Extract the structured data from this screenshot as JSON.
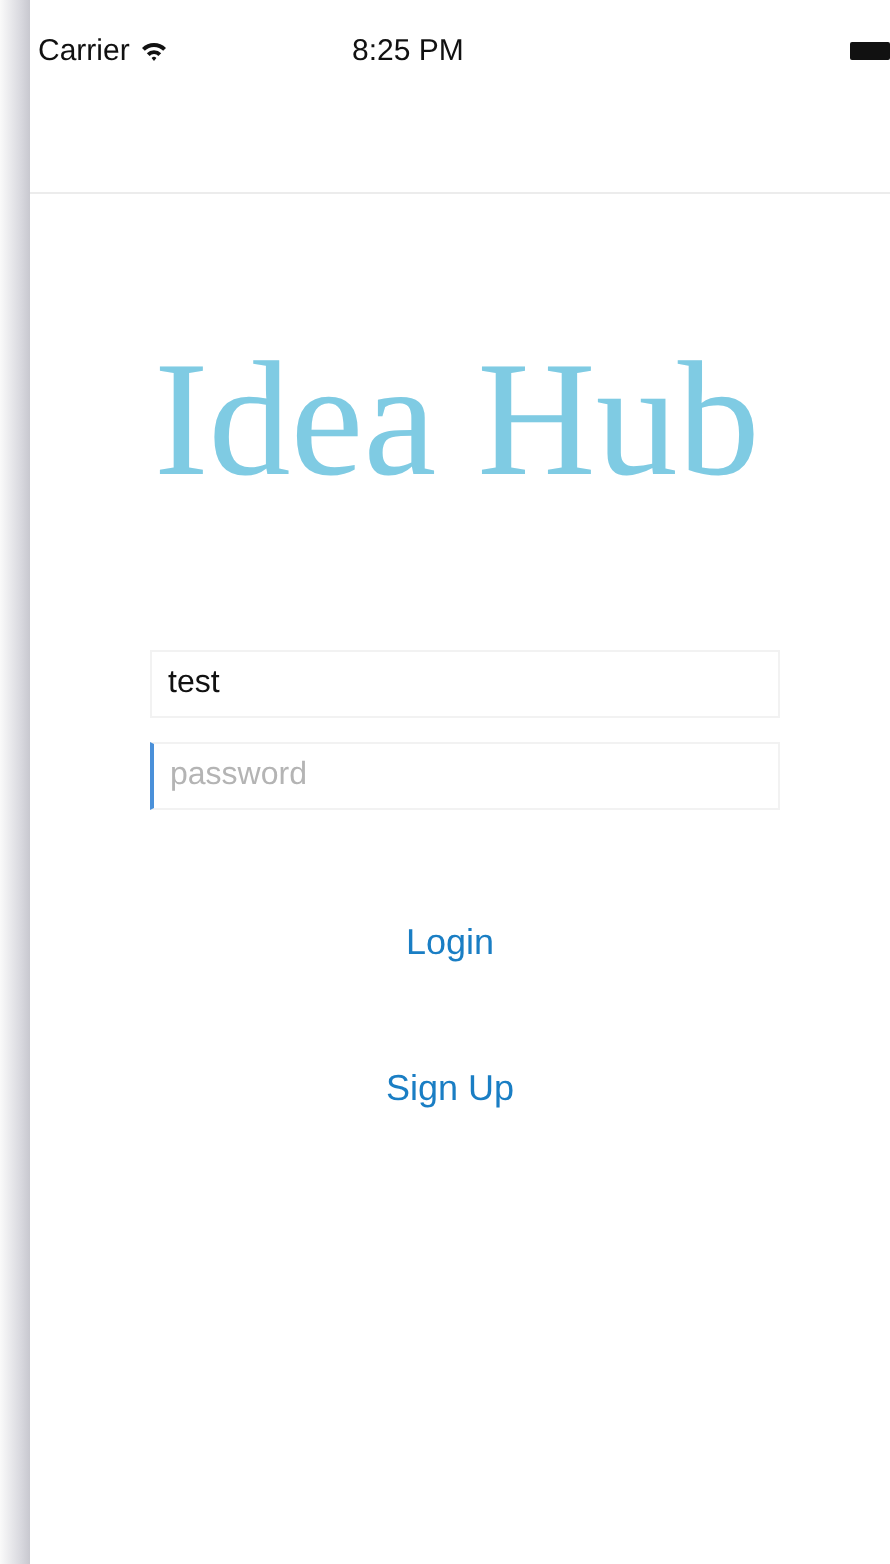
{
  "status_bar": {
    "carrier": "Carrier",
    "time": "8:25 PM"
  },
  "title": "Idea Hub",
  "fields": [
    {
      "kind": "username",
      "value": "test",
      "focused": false
    },
    {
      "kind": "password",
      "placeholder": "password",
      "focused": true
    }
  ],
  "buttons": [
    {
      "label": "Login"
    },
    {
      "label": "Sign Up"
    }
  ]
}
